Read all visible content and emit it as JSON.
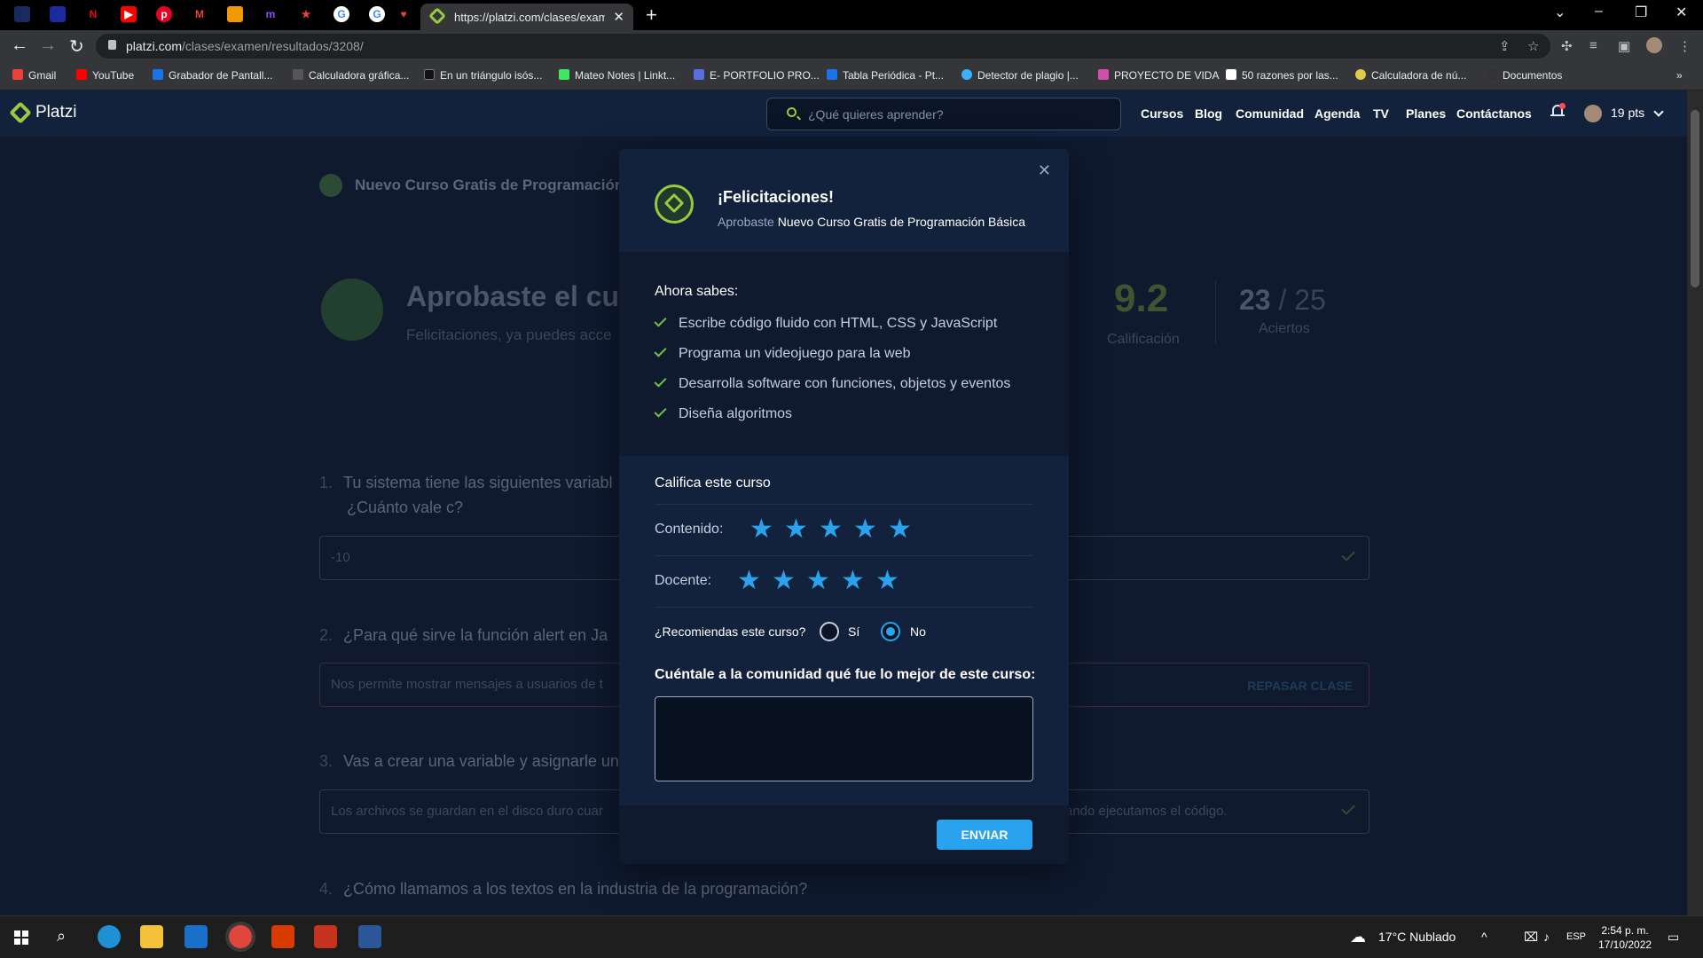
{
  "browser": {
    "tab_title": "https://platzi.com/clases/examen...",
    "url_host": "platzi.com",
    "url_path": "/clases/examen/resultados/3208/",
    "bookmarks": [
      "Gmail",
      "YouTube",
      "Grabador de Pantall...",
      "Calculadora gráfica...",
      "En un triángulo isós...",
      "Mateo Notes | Linkt...",
      "E- PORTFOLIO PRO...",
      "Tabla Periódica - Pt...",
      "Detector de plagio |...",
      "PROYECTO DE VIDA",
      "50 razones por las...",
      "Calculadora de nú...",
      "Documentos"
    ]
  },
  "header": {
    "logo": "Platzi",
    "search_placeholder": "¿Qué quieres aprender?",
    "nav": [
      "Cursos",
      "Blog",
      "Comunidad",
      "Agenda",
      "TV",
      "Planes",
      "Contáctanos"
    ],
    "points": "19 pts"
  },
  "page": {
    "course_name": "Nuevo Curso Gratis de Programación",
    "pass_title": "Aprobaste el curs",
    "pass_sub": "Felicitaciones, ya puedes acce",
    "score": "9.2",
    "score_label": "Calificación",
    "hits": "23",
    "hits_total": "/ 25",
    "hits_label": "Aciertos",
    "questions": [
      {
        "n": "1.",
        "text": "Tu sistema tiene las siguientes variabl",
        "text2": "¿Cuánto vale c?",
        "answer": "-10"
      },
      {
        "n": "2.",
        "text": "¿Para qué sirve la función alert en Ja",
        "answer": "Nos permite mostrar mensajes a usuarios de t",
        "action": "REPASAR CLASE"
      },
      {
        "n": "3.",
        "text": "Vas a crear una variable y asignarle un",
        "answer": "Los archivos se guardan en el disco duro cuar",
        "answer_right": "ando ejecutamos el código."
      },
      {
        "n": "4.",
        "text": "¿Cómo llamamos a los textos en la industria de la programación?"
      }
    ]
  },
  "modal": {
    "title": "¡Felicitaciones!",
    "sub_prefix": "Aprobaste",
    "sub_course": "Nuevo Curso Gratis de Programación Básica",
    "learn_heading": "Ahora sabes:",
    "learn_items": [
      "Escribe código fluido con HTML, CSS y JavaScript",
      "Programa un videojuego para la web",
      "Desarrolla software con funciones, objetos y eventos",
      "Diseña algoritmos"
    ],
    "rate_heading": "Califica este curso",
    "content_label": "Contenido:",
    "teacher_label": "Docente:",
    "content_rating": 5,
    "teacher_rating": 5,
    "recommend_label": "¿Recomiendas este curso?",
    "yes_label": "Sí",
    "no_label": "No",
    "recommend_selected": "No",
    "tell_label": "Cuéntale a la comunidad qué fue lo mejor de este curso:",
    "comment_value": "",
    "send_label": "ENVIAR"
  },
  "taskbar": {
    "weather": "17°C  Nublado",
    "lang": "ESP",
    "time": "2:54 p. m.",
    "date": "17/10/2022"
  },
  "colors": {
    "accent_blue": "#2aa3ef",
    "platzi_green": "#98ca3f",
    "modal_bg": "#13223c"
  }
}
